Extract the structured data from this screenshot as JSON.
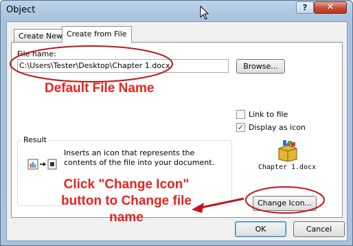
{
  "window": {
    "title": "Object",
    "help_label": "?",
    "close_label": "✕"
  },
  "tabs": [
    {
      "label": "Create New",
      "selected": false
    },
    {
      "label": "Create from File",
      "selected": true
    }
  ],
  "file_name": {
    "label": "File name:",
    "value": "C:\\Users\\Tester\\Desktop\\Chapter 1.docx"
  },
  "buttons": {
    "browse": "Browse...",
    "change_icon": "Change Icon...",
    "ok": "OK",
    "cancel": "Cancel"
  },
  "options": {
    "link_to_file": {
      "label": "Link to file",
      "checked": false
    },
    "display_as_icon": {
      "label": "Display as icon",
      "checked": true
    }
  },
  "result": {
    "title": "Result",
    "text": "Inserts an icon that represents the contents of the file into your document."
  },
  "icon_preview": {
    "caption": "Chapter 1.docx",
    "icon": "package-icon"
  },
  "annotations": {
    "default_file_name": "Default File Name",
    "change_icon_note": "Click \"Change Icon\" button to Change file name",
    "color": "#e5231d"
  }
}
